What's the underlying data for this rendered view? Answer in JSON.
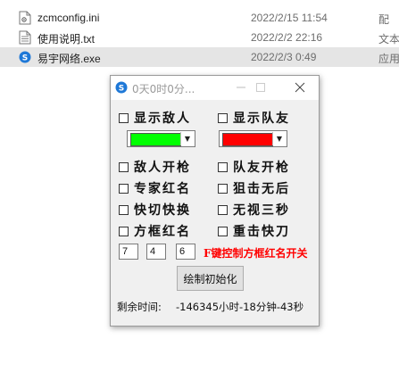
{
  "files": [
    {
      "name": "zcmconfig.ini",
      "date": "2022/2/15 11:54",
      "type": "配",
      "icon": "config-file-icon"
    },
    {
      "name": "使用说明.txt",
      "date": "2022/2/2 22:16",
      "type": "文本",
      "icon": "text-file-icon"
    },
    {
      "name": "易宇网络.exe",
      "date": "2022/2/3 0:49",
      "type": "应用",
      "icon": "app-exe-icon",
      "selected": true
    }
  ],
  "window": {
    "title": "0天0时0分...",
    "icon": "app-logo-icon"
  },
  "options": {
    "show_enemy": "显示敌人",
    "show_teammate": "显示队友",
    "enemy_fire": "敌人开枪",
    "teammate_fire": "队友开枪",
    "expert_red_name": "专家红名",
    "sniper_no_sway": "狙击无后",
    "quick_switch": "快切快换",
    "ignore_smoke": "无视三秒",
    "box_red_name": "方框红名",
    "heavy_quick_knife": "重击快刀"
  },
  "colors": {
    "enemy": "#00ff00",
    "teammate": "#ff0000"
  },
  "inputs": {
    "value_1": "7",
    "value_2": "4",
    "value_3": "6"
  },
  "hotkey_note": "F键控制方框红名开关",
  "init_button": "绘制初始化",
  "remaining": {
    "label": "剩余时间:",
    "value": "-146345小时-18分钟-43秒"
  }
}
